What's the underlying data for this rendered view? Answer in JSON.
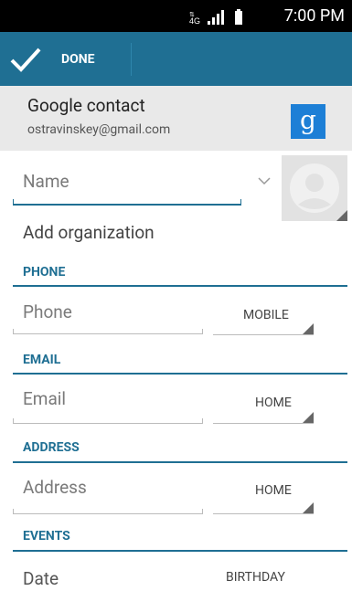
{
  "status_bar": {
    "network": "4G",
    "time": "7:00 PM"
  },
  "action_bar": {
    "done_label": "DONE"
  },
  "account": {
    "name": "Google contact",
    "email": "ostravinskey@gmail.com",
    "badge": "g"
  },
  "name_field": {
    "placeholder": "Name"
  },
  "organization": {
    "label": "Add organization"
  },
  "phone": {
    "section": "PHONE",
    "placeholder": "Phone",
    "type": "MOBILE"
  },
  "email": {
    "section": "EMAIL",
    "placeholder": "Email",
    "type": "HOME"
  },
  "address": {
    "section": "ADDRESS",
    "placeholder": "Address",
    "type": "HOME"
  },
  "events": {
    "section": "EVENTS",
    "placeholder": "Date",
    "type": "BIRTHDAY"
  }
}
